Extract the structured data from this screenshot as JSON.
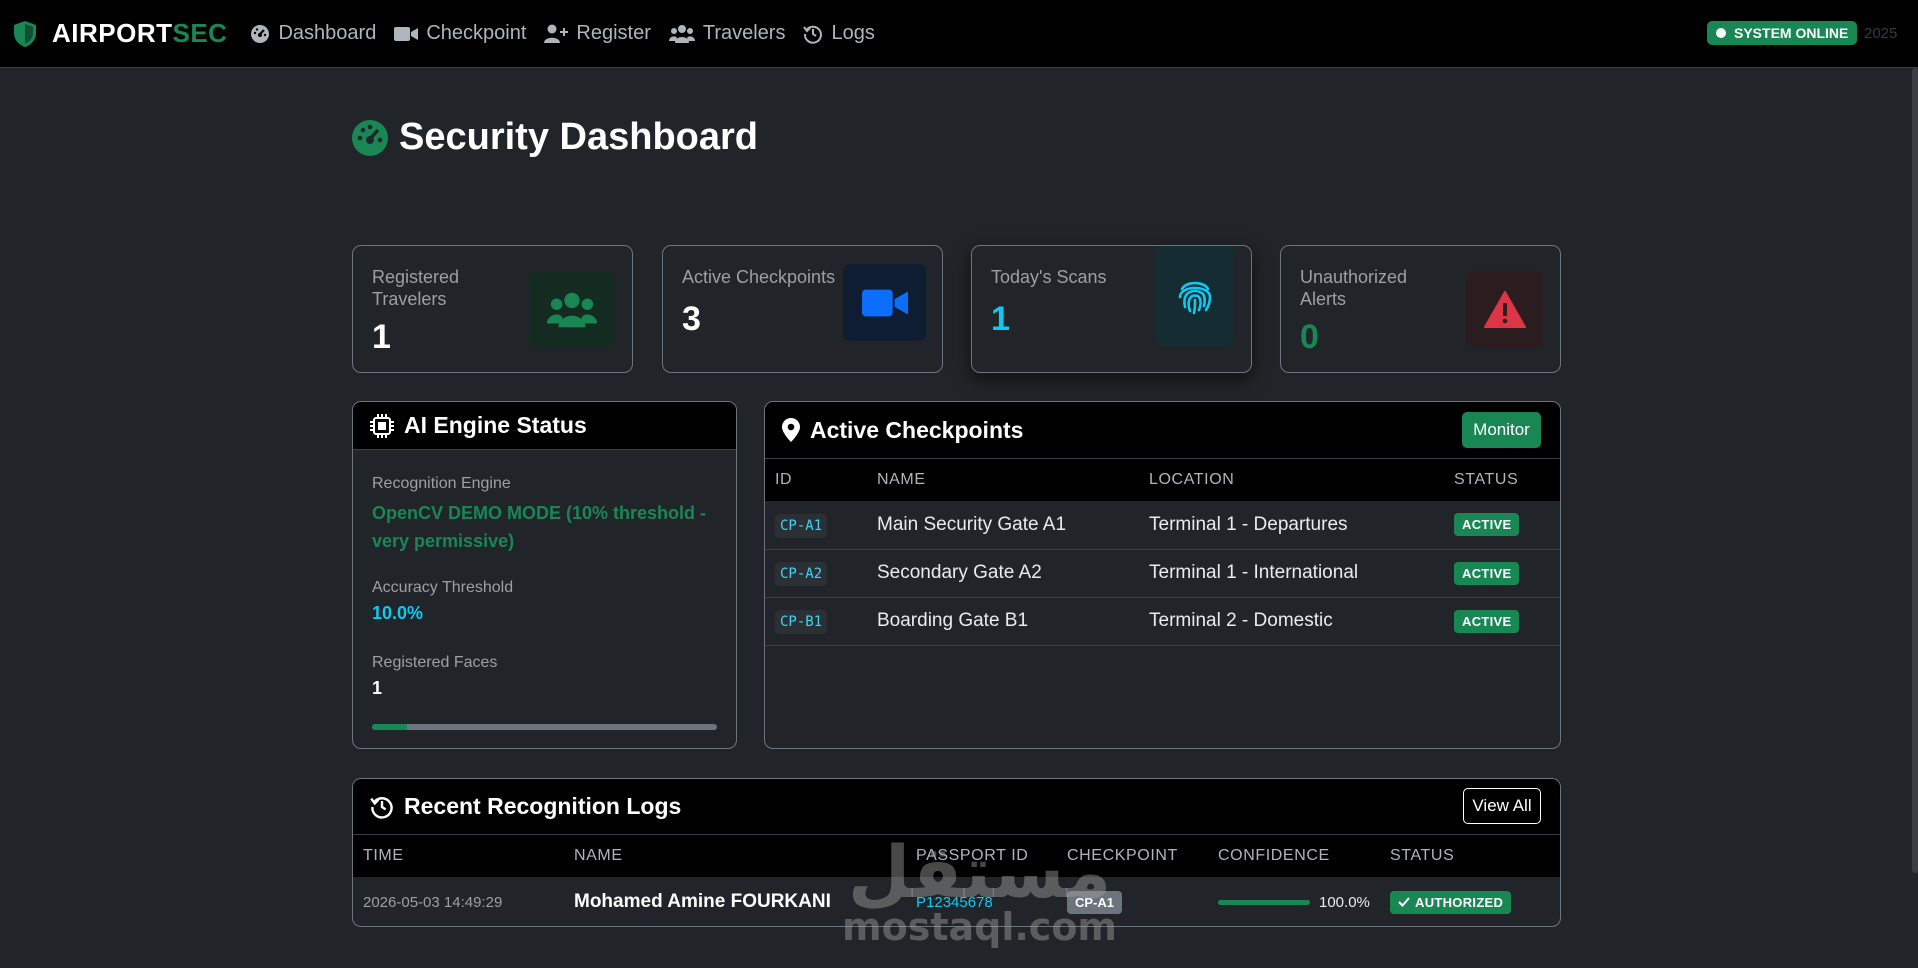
{
  "nav": {
    "brand_main": "AIRPORT",
    "brand_accent": "SEC",
    "items": [
      {
        "label": "Dashboard",
        "icon": "gauge-icon"
      },
      {
        "label": "Checkpoint",
        "icon": "video-camera-icon"
      },
      {
        "label": "Register",
        "icon": "user-plus-icon"
      },
      {
        "label": "Travelers",
        "icon": "users-icon"
      },
      {
        "label": "Logs",
        "icon": "history-icon"
      }
    ],
    "status": "SYSTEM ONLINE",
    "year": "2025"
  },
  "page": {
    "title": "Security Dashboard"
  },
  "stats": [
    {
      "label": "Registered Travelers",
      "value": "1",
      "icon": "users-icon",
      "color": "#198754"
    },
    {
      "label": "Active Checkpoints",
      "value": "3",
      "icon": "video-camera-icon",
      "color": "#0d6efd"
    },
    {
      "label": "Today's Scans",
      "value": "1",
      "icon": "fingerprint-icon",
      "color": "#0dcaf0"
    },
    {
      "label": "Unauthorized Alerts",
      "value": "0",
      "icon": "warning-triangle-icon",
      "color": "#dc3545"
    }
  ],
  "ai_engine": {
    "title": "AI Engine Status",
    "engine_label": "Recognition Engine",
    "engine_value": "OpenCV DEMO MODE (10% threshold - very permissive)",
    "threshold_label": "Accuracy Threshold",
    "threshold_value": "10.0%",
    "faces_label": "Registered Faces",
    "faces_value": "1",
    "faces_progress": 0.1
  },
  "checkpoints": {
    "title": "Active Checkpoints",
    "button": "Monitor",
    "columns": [
      "ID",
      "NAME",
      "LOCATION",
      "STATUS"
    ],
    "rows": [
      {
        "id": "CP-A1",
        "name": "Main Security Gate A1",
        "location": "Terminal 1 - Departures",
        "status": "ACTIVE"
      },
      {
        "id": "CP-A2",
        "name": "Secondary Gate A2",
        "location": "Terminal 1 - International",
        "status": "ACTIVE"
      },
      {
        "id": "CP-B1",
        "name": "Boarding Gate B1",
        "location": "Terminal 2 - Domestic",
        "status": "ACTIVE"
      }
    ]
  },
  "logs": {
    "title": "Recent Recognition Logs",
    "button": "View All",
    "columns": [
      "TIME",
      "NAME",
      "PASSPORT ID",
      "CHECKPOINT",
      "CONFIDENCE",
      "STATUS"
    ],
    "rows": [
      {
        "time": "2026-05-03 14:49:29",
        "name": "Mohamed Amine FOURKANI",
        "passport": "P12345678",
        "checkpoint": "CP-A1",
        "confidence": "100.0%",
        "confidence_value": 1.0,
        "status": "AUTHORIZED"
      }
    ]
  },
  "watermark": {
    "arabic": "مستقل",
    "latin": "mostaql.com"
  }
}
